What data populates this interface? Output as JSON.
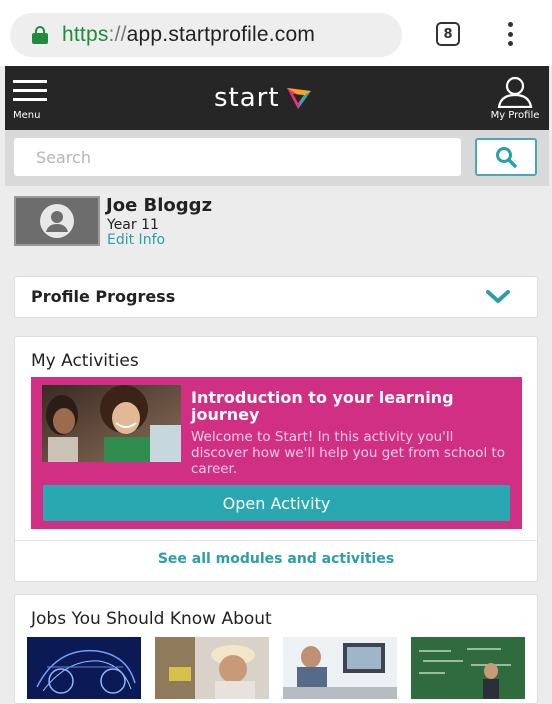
{
  "browser": {
    "url_scheme": "https",
    "url_sep": "://",
    "url_host": "app.startprofile.com",
    "tab_count": "8"
  },
  "header": {
    "menu_label": "Menu",
    "logo_text": "start",
    "profile_label": "My Profile",
    "background": "#262626"
  },
  "search": {
    "placeholder": "Search",
    "value": ""
  },
  "user": {
    "name": "Joe Bloggz",
    "year": "Year 11",
    "edit_label": "Edit Info"
  },
  "profile_progress": {
    "title": "Profile Progress"
  },
  "activities": {
    "title": "My Activities",
    "items": [
      {
        "heading": "Introduction to your learning journey",
        "description": "Welcome to Start! In this activity you'll discover how we'll help you get from school to career.",
        "button_label": "Open Activity"
      }
    ],
    "see_all_label": "See all modules and activities"
  },
  "jobs": {
    "title": "Jobs You Should Know About"
  },
  "colors": {
    "accent": "#2aa8b2",
    "activity_tile": "#d12f83",
    "secure": "#1e8c3a"
  }
}
